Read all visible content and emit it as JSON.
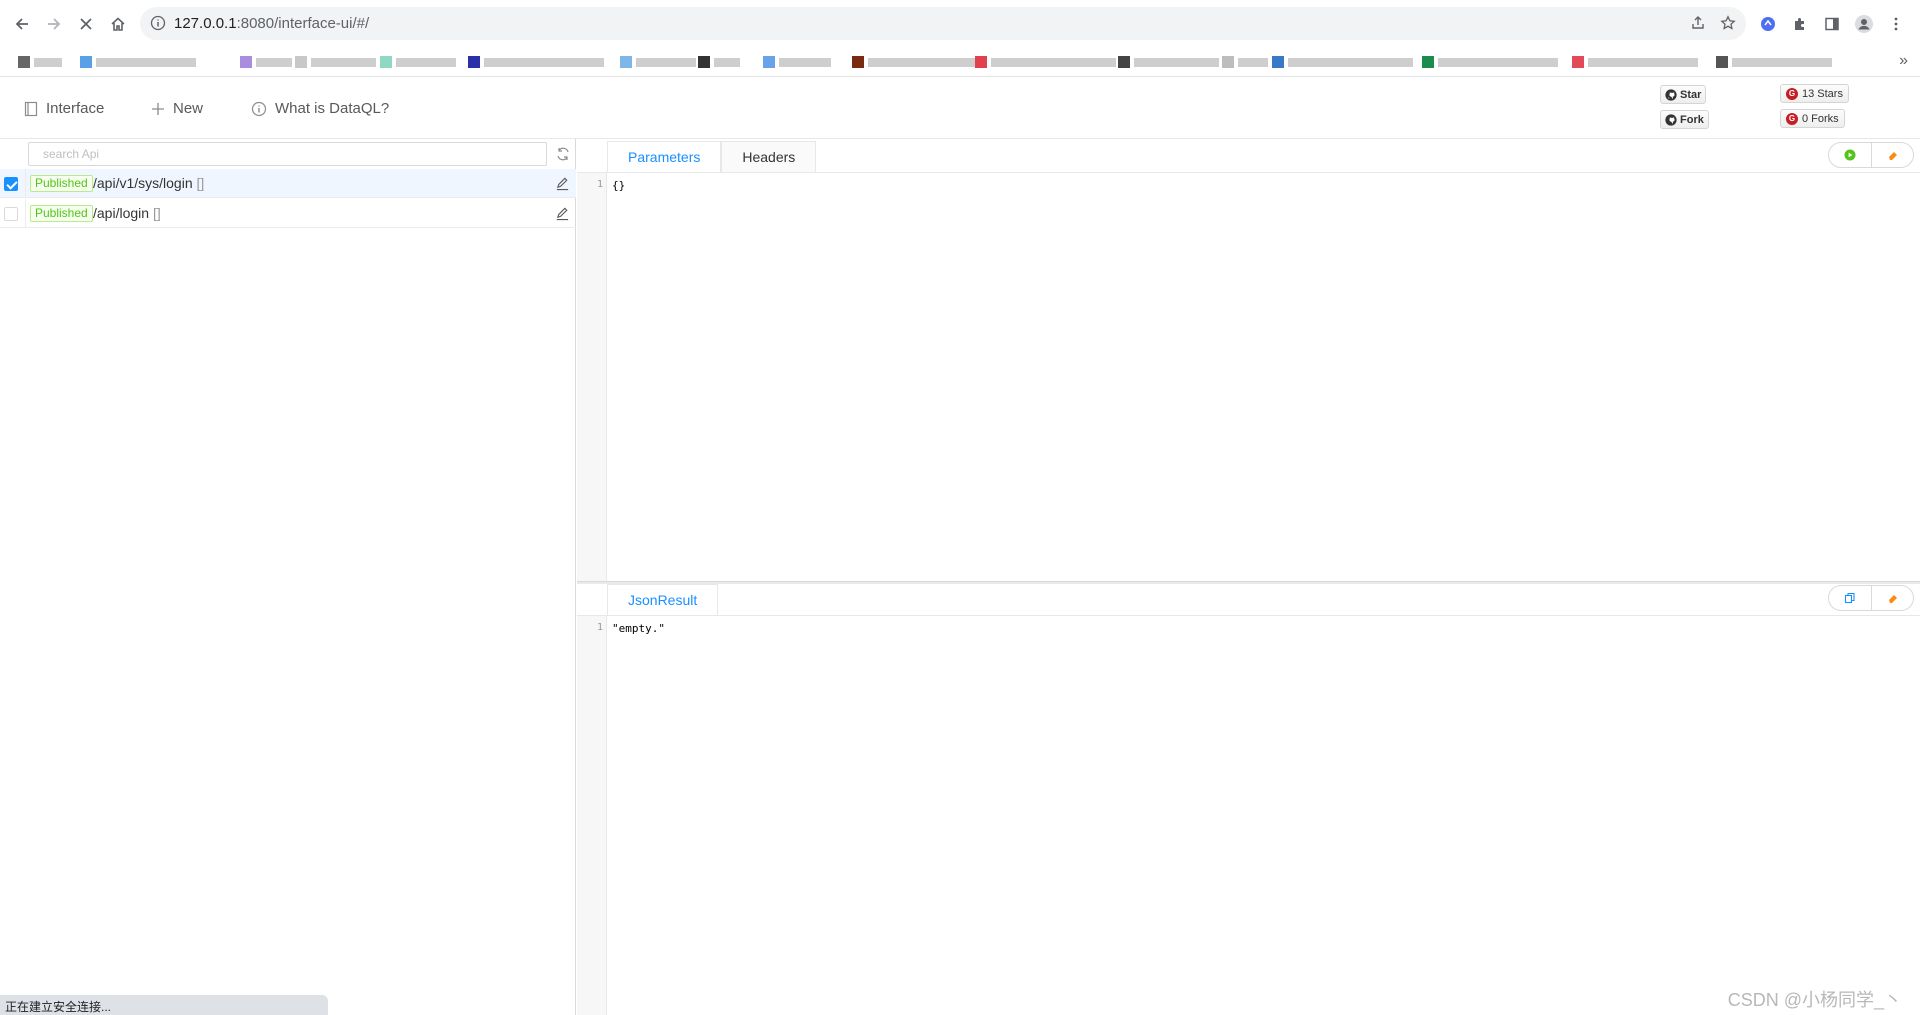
{
  "browser": {
    "url_host": "127.0.0.1",
    "url_path": ":8080/interface-ui/#/",
    "status_text": "正在建立安全连接...",
    "more_label": "»"
  },
  "header": {
    "menu": [
      {
        "label": "Interface",
        "icon": "interface-icon"
      },
      {
        "label": "New",
        "icon": "plus-icon"
      },
      {
        "label": "What is DataQL?",
        "icon": "info-icon"
      }
    ],
    "github": {
      "star_label": "Star",
      "fork_label": "Fork"
    },
    "gitee": {
      "stars_label": "13 Stars",
      "forks_label": "0 Forks"
    },
    "colors": {
      "accent": "#1890ff",
      "published": "#52c41a",
      "gitee": "#c71d23"
    }
  },
  "sidebar": {
    "search_placeholder": "search Api",
    "apis": [
      {
        "status": "Published",
        "path": "/api/v1/sys/login",
        "suffix": "[]",
        "selected": true
      },
      {
        "status": "Published",
        "path": "/api/login",
        "suffix": "[]",
        "selected": false
      }
    ]
  },
  "request": {
    "tabs": [
      {
        "label": "Parameters",
        "active": true
      },
      {
        "label": "Headers",
        "active": false
      }
    ],
    "line_number": "1",
    "content": "{}"
  },
  "result": {
    "tabs": [
      {
        "label": "JsonResult",
        "active": true
      }
    ],
    "line_number": "1",
    "content": "\"empty.\""
  },
  "watermark": "CSDN @小杨同学_丶"
}
